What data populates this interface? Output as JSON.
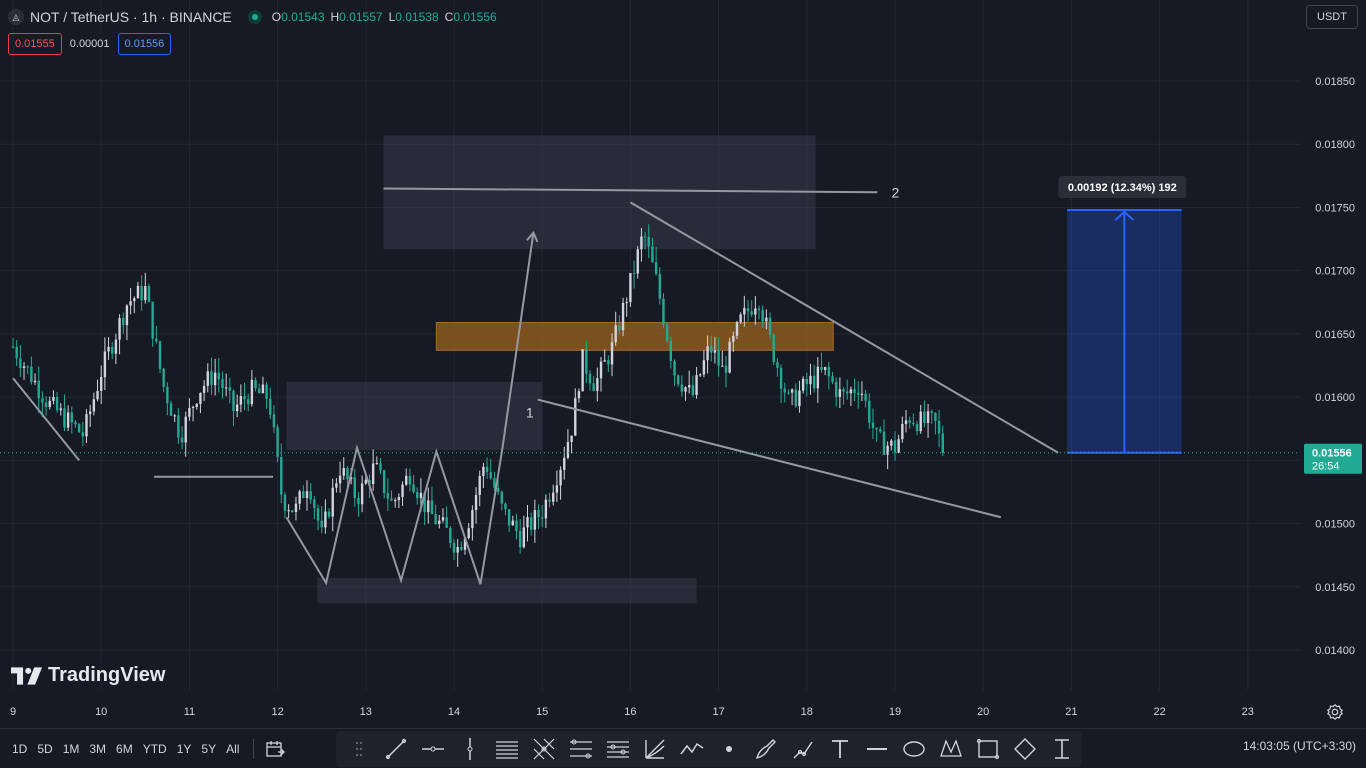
{
  "header": {
    "symbol_icon": "coin-logo-icon",
    "title": "NOT / TetherUS · 1h · BINANCE",
    "ohlc": [
      {
        "key": "O",
        "value": "0.01543"
      },
      {
        "key": "H",
        "value": "0.01557"
      },
      {
        "key": "L",
        "value": "0.01538"
      },
      {
        "key": "C",
        "value": "0.01556"
      }
    ],
    "sell_price": "0.01555",
    "spread": "0.00001",
    "buy_price": "0.01556",
    "currency": "USDT"
  },
  "colors": {
    "background": "#161a25",
    "up": "#22ab94",
    "down": "#f23645",
    "candle_up": "#d1d4dc",
    "candle_down": "#22ab94",
    "accent_blue": "#2962ff",
    "drawing": "#9598a1",
    "orange_zone": "#8c5a1f"
  },
  "chart_data": {
    "type": "candlestick",
    "symbol": "NOT / TetherUS",
    "interval": "1h",
    "ylim": [
      0.01355,
      0.01915
    ],
    "xlim": [
      9.0,
      23.9
    ],
    "y_ticks": [
      "0.01400",
      "0.01450",
      "0.01500",
      "0.01550",
      "0.01600",
      "0.01650",
      "0.01700",
      "0.01750",
      "0.01800",
      "0.01850"
    ],
    "x_ticks": [
      "9",
      "10",
      "11",
      "12",
      "13",
      "14",
      "15",
      "16",
      "17",
      "18",
      "19",
      "20",
      "21",
      "22",
      "23"
    ],
    "last_price": "0.01556",
    "countdown": "26:54",
    "price_path": [
      [
        9.0,
        0.0164
      ],
      [
        9.4,
        0.01595
      ],
      [
        9.8,
        0.0157
      ],
      [
        10.0,
        0.0162
      ],
      [
        10.3,
        0.01675
      ],
      [
        10.5,
        0.01685
      ],
      [
        10.7,
        0.0161
      ],
      [
        10.9,
        0.0157
      ],
      [
        11.1,
        0.01605
      ],
      [
        11.3,
        0.0162
      ],
      [
        11.5,
        0.0159
      ],
      [
        11.7,
        0.01605
      ],
      [
        11.9,
        0.016
      ],
      [
        12.05,
        0.0152
      ],
      [
        12.2,
        0.0151
      ],
      [
        12.35,
        0.01535
      ],
      [
        12.5,
        0.0149
      ],
      [
        12.7,
        0.01545
      ],
      [
        12.9,
        0.0152
      ],
      [
        13.1,
        0.01545
      ],
      [
        13.3,
        0.01515
      ],
      [
        13.5,
        0.0154
      ],
      [
        13.7,
        0.0151
      ],
      [
        13.9,
        0.01495
      ],
      [
        14.05,
        0.0148
      ],
      [
        14.2,
        0.0151
      ],
      [
        14.35,
        0.0155
      ],
      [
        14.55,
        0.0151
      ],
      [
        14.75,
        0.0149
      ],
      [
        15.0,
        0.0151
      ],
      [
        15.2,
        0.01545
      ],
      [
        15.35,
        0.0158
      ],
      [
        15.45,
        0.0163
      ],
      [
        15.6,
        0.0161
      ],
      [
        15.8,
        0.0164
      ],
      [
        16.0,
        0.0169
      ],
      [
        16.15,
        0.0173
      ],
      [
        16.3,
        0.0169
      ],
      [
        16.5,
        0.0162
      ],
      [
        16.7,
        0.016
      ],
      [
        16.9,
        0.0164
      ],
      [
        17.05,
        0.0162
      ],
      [
        17.25,
        0.0166
      ],
      [
        17.45,
        0.0168
      ],
      [
        17.6,
        0.0164
      ],
      [
        17.8,
        0.01595
      ],
      [
        18.0,
        0.0161
      ],
      [
        18.2,
        0.0162
      ],
      [
        18.4,
        0.016
      ],
      [
        18.6,
        0.0161
      ],
      [
        18.8,
        0.01565
      ],
      [
        19.0,
        0.0156
      ],
      [
        19.15,
        0.01585
      ],
      [
        19.3,
        0.0158
      ],
      [
        19.45,
        0.0158
      ],
      [
        19.55,
        0.01556
      ]
    ],
    "drawings": [
      {
        "type": "horizontal_line",
        "label": "2",
        "x": [
          13.2,
          18.8
        ],
        "y": [
          0.01765,
          0.01762
        ]
      },
      {
        "type": "rectangle",
        "x": [
          13.2,
          18.1
        ],
        "y": [
          0.01717,
          0.01807
        ]
      },
      {
        "type": "rectangle",
        "color": "orange",
        "x": [
          13.8,
          18.3
        ],
        "y": [
          0.01637,
          0.01659
        ]
      },
      {
        "type": "rectangle",
        "x": [
          12.1,
          15.0
        ],
        "y": [
          0.01558,
          0.01612
        ]
      },
      {
        "type": "rectangle",
        "x": [
          12.45,
          16.75
        ],
        "y": [
          0.01437,
          0.01457
        ]
      },
      {
        "type": "trend_line",
        "label": "1",
        "x": [
          14.95,
          20.2
        ],
        "y": [
          0.01598,
          0.01505
        ]
      },
      {
        "type": "trend_line",
        "x": [
          16.0,
          20.85
        ],
        "y": [
          0.01754,
          0.01556
        ]
      },
      {
        "type": "horizontal_line",
        "x": [
          10.6,
          11.95
        ],
        "y": [
          0.01537,
          0.01537
        ]
      },
      {
        "type": "trend_line",
        "x": [
          9.0,
          9.75
        ],
        "y": [
          0.01615,
          0.0155
        ]
      },
      {
        "type": "polyline",
        "x": [
          12.1,
          12.55,
          12.9,
          13.4,
          13.8,
          14.3,
          14.55,
          14.9
        ],
        "y": [
          0.01505,
          0.01453,
          0.0156,
          0.01455,
          0.01557,
          0.01452,
          0.0156,
          0.0173
        ]
      },
      {
        "type": "long_position",
        "label": "0.00192 (12.34%) 192",
        "x": [
          20.95,
          22.25
        ],
        "y": [
          0.01556,
          0.01748
        ]
      }
    ]
  },
  "logo": {
    "text": "TradingView",
    "icon": "tradingview-logo-icon"
  },
  "bottombar": {
    "ranges": [
      "1D",
      "5D",
      "1M",
      "3M",
      "6M",
      "YTD",
      "1Y",
      "5Y",
      "All"
    ],
    "date_range_icon": "date-range-icon",
    "clock": "14:03:05 (UTC+3:30)"
  },
  "drawing_tools": [
    "drag-handle-icon",
    "trend-line-icon",
    "horizontal-ray-icon",
    "vertical-line-icon",
    "parallel-channel-icon",
    "pitchfork-icon",
    "fib-retracement-icon",
    "fib-extension-icon",
    "gann-fan-icon",
    "zigzag-icon",
    "dot-icon",
    "brush-icon",
    "path-icon",
    "text-icon",
    "price-range-icon",
    "ellipse-icon",
    "xabcd-pattern-icon",
    "rectangle-icon",
    "polygon-icon",
    "measure-icon"
  ],
  "settings_icon": "gear-icon"
}
